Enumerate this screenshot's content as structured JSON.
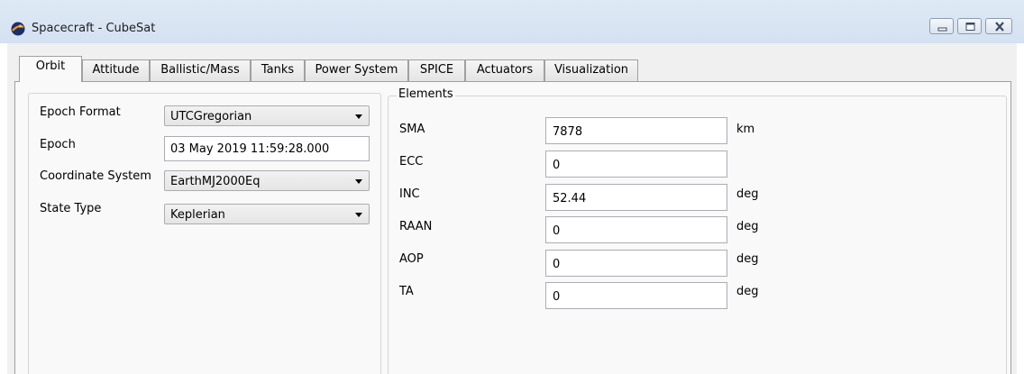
{
  "window": {
    "title": "Spacecraft - CubeSat",
    "icon": "gmat-logo-icon",
    "controls": [
      "minimize-icon",
      "maximize-icon",
      "close-icon"
    ]
  },
  "tabs": [
    {
      "label": "Orbit",
      "active": true
    },
    {
      "label": "Attitude",
      "active": false
    },
    {
      "label": "Ballistic/Mass",
      "active": false
    },
    {
      "label": "Tanks",
      "active": false
    },
    {
      "label": "Power System",
      "active": false
    },
    {
      "label": "SPICE",
      "active": false
    },
    {
      "label": "Actuators",
      "active": false
    },
    {
      "label": "Visualization",
      "active": false
    }
  ],
  "left_panel": {
    "epoch_format": {
      "label": "Epoch Format",
      "value": "UTCGregorian"
    },
    "epoch": {
      "label": "Epoch",
      "value": "03 May 2019 11:59:28.000"
    },
    "coordinate_system": {
      "label": "Coordinate System",
      "value": "EarthMJ2000Eq"
    },
    "state_type": {
      "label": "State Type",
      "value": "Keplerian"
    }
  },
  "elements": {
    "caption": "Elements",
    "rows": [
      {
        "label": "SMA",
        "value": "7878",
        "unit": "km"
      },
      {
        "label": "ECC",
        "value": "0",
        "unit": ""
      },
      {
        "label": "INC",
        "value": "52.44",
        "unit": "deg"
      },
      {
        "label": "RAAN",
        "value": "0",
        "unit": "deg"
      },
      {
        "label": "AOP",
        "value": "0",
        "unit": "deg"
      },
      {
        "label": "TA",
        "value": "0",
        "unit": "deg"
      }
    ]
  },
  "colors": {
    "titlebar": "#d9e5f3",
    "client": "#f0f0f0",
    "panel": "#f9f9f9"
  }
}
